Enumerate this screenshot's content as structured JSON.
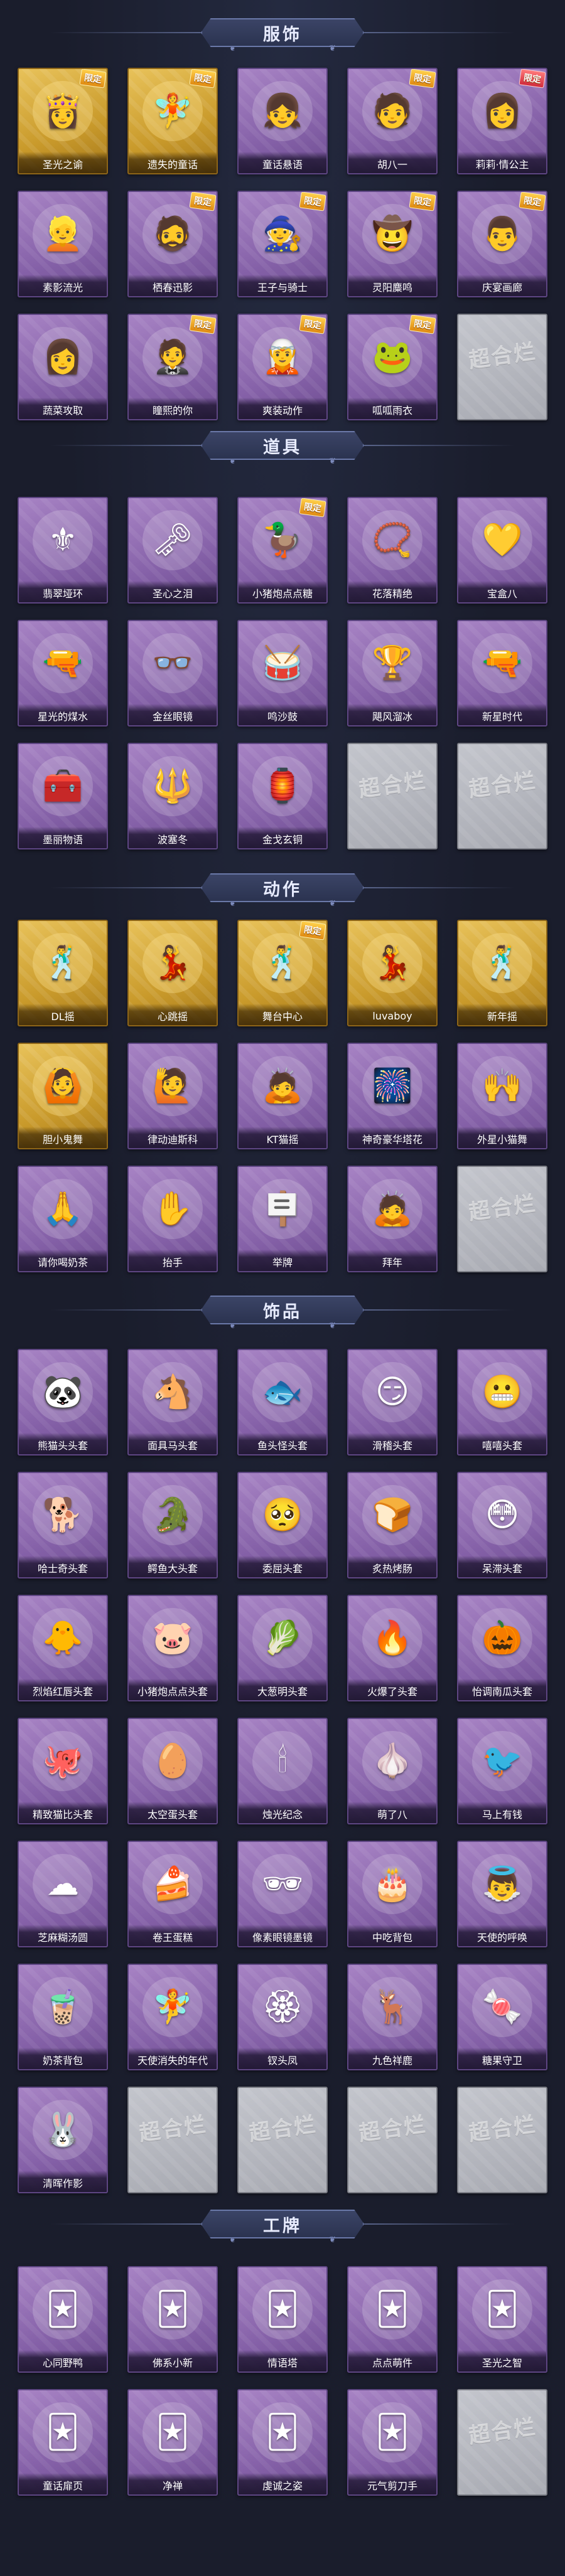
{
  "placeholder_logo": "超合烂",
  "sections": [
    {
      "title": "服饰",
      "items": [
        {
          "name": "圣光之谕",
          "tier": "gold",
          "icon": "girl-portrait",
          "glyph": "👸",
          "badge": "限定"
        },
        {
          "name": "遗失的童话",
          "tier": "gold",
          "icon": "girl-portrait",
          "glyph": "🧚",
          "badge": "限定"
        },
        {
          "name": "童话悬语",
          "tier": "purple",
          "icon": "girl-portrait",
          "glyph": "👧"
        },
        {
          "name": "胡八一",
          "tier": "purple",
          "icon": "boy-portrait",
          "glyph": "🧑",
          "badge": "限定"
        },
        {
          "name": "莉莉·情公主",
          "tier": "purple",
          "icon": "girl-portrait",
          "glyph": "👩",
          "badge": "限定",
          "badge_color": "red"
        },
        {
          "name": "素影流光",
          "tier": "purple",
          "icon": "girl-portrait",
          "glyph": "👱"
        },
        {
          "name": "栖春迅影",
          "tier": "purple",
          "icon": "boy-portrait",
          "glyph": "🧔",
          "badge": "限定"
        },
        {
          "name": "王子与骑士",
          "tier": "purple",
          "icon": "boy-portrait",
          "glyph": "🧙",
          "badge": "限定"
        },
        {
          "name": "灵阳麋鸣",
          "tier": "purple",
          "icon": "boy-portrait",
          "glyph": "🤠",
          "badge": "限定"
        },
        {
          "name": "庆宴画廊",
          "tier": "purple",
          "icon": "boy-portrait",
          "glyph": "👨",
          "badge": "限定"
        },
        {
          "name": "蔬菜攻取",
          "tier": "purple",
          "icon": "girl-portrait",
          "glyph": "👩"
        },
        {
          "name": "瞳熙的你",
          "tier": "purple",
          "icon": "girl-portrait",
          "glyph": "🤵",
          "badge": "限定"
        },
        {
          "name": "爽装动作",
          "tier": "purple",
          "icon": "girl-portrait",
          "glyph": "🧝",
          "badge": "限定"
        },
        {
          "name": "呱呱雨衣",
          "tier": "purple",
          "icon": "frog-portrait",
          "glyph": "🐸",
          "badge": "限定"
        },
        {
          "name": "",
          "tier": "grey",
          "icon": "placeholder-logo",
          "glyph": ""
        }
      ]
    },
    {
      "title": "道具",
      "items": [
        {
          "name": "翡翠垭环",
          "tier": "purple",
          "icon": "scepter-icon",
          "glyph": "⚜"
        },
        {
          "name": "圣心之泪",
          "tier": "purple",
          "icon": "key-icon",
          "glyph": "🗝"
        },
        {
          "name": "小猪炮点点糖",
          "tier": "purple",
          "icon": "duck-icon",
          "glyph": "🦆",
          "badge": "限定"
        },
        {
          "name": "花落精绝",
          "tier": "purple",
          "icon": "necklace-icon",
          "glyph": "📿"
        },
        {
          "name": "宝盒八",
          "tier": "purple",
          "icon": "heart-locket-icon",
          "glyph": "💛"
        },
        {
          "name": "星光的煤水",
          "tier": "purple",
          "icon": "rifle-icon",
          "glyph": "🔫"
        },
        {
          "name": "金丝眼镜",
          "tier": "purple",
          "icon": "glasses-icon",
          "glyph": "👓"
        },
        {
          "name": "鸣沙鼓",
          "tier": "purple",
          "icon": "drum-icon",
          "glyph": "🥁"
        },
        {
          "name": "飓风溜冰",
          "tier": "purple",
          "icon": "trophy-icon",
          "glyph": "🏆"
        },
        {
          "name": "新星时代",
          "tier": "purple",
          "icon": "pistol-icon",
          "glyph": "🔫"
        },
        {
          "name": "墨丽物语",
          "tier": "purple",
          "icon": "medkit-icon",
          "glyph": "🧰"
        },
        {
          "name": "波塞冬",
          "tier": "purple",
          "icon": "trident-icon",
          "glyph": "🔱"
        },
        {
          "name": "金戈玄铜",
          "tier": "purple",
          "icon": "lantern-icon",
          "glyph": "🏮"
        },
        {
          "name": "",
          "tier": "grey",
          "icon": "placeholder-logo",
          "glyph": ""
        },
        {
          "name": "",
          "tier": "grey",
          "icon": "placeholder-logo",
          "glyph": ""
        }
      ]
    },
    {
      "title": "动作",
      "items": [
        {
          "name": "DL摇",
          "tier": "gold",
          "icon": "dance-pose-icon",
          "glyph": "🕺"
        },
        {
          "name": "心跳摇",
          "tier": "gold",
          "icon": "dance-pose-icon",
          "glyph": "💃"
        },
        {
          "name": "舞台中心",
          "tier": "gold",
          "icon": "dance-pose-icon",
          "glyph": "🕺",
          "badge": "限定"
        },
        {
          "name": "luvaboy",
          "tier": "gold",
          "icon": "dance-pose-icon",
          "glyph": "💃"
        },
        {
          "name": "新年摇",
          "tier": "gold",
          "icon": "dance-pose-icon",
          "glyph": "🕺"
        },
        {
          "name": "胆小鬼舞",
          "tier": "gold",
          "icon": "dance-pose-icon",
          "glyph": "🙆"
        },
        {
          "name": "律动迪斯科",
          "tier": "purple",
          "icon": "dance-pose-icon",
          "glyph": "🙋"
        },
        {
          "name": "KT猫摇",
          "tier": "purple",
          "icon": "dance-pose-icon",
          "glyph": "🙇"
        },
        {
          "name": "神奇豪华塔花",
          "tier": "purple",
          "icon": "firework-icon",
          "glyph": "🎆"
        },
        {
          "name": "外星小猫舞",
          "tier": "purple",
          "icon": "dance-pose-icon",
          "glyph": "🙌"
        },
        {
          "name": "请你喝奶茶",
          "tier": "purple",
          "icon": "dance-pose-icon",
          "glyph": "🙏"
        },
        {
          "name": "抬手",
          "tier": "purple",
          "icon": "dance-pose-icon",
          "glyph": "✋"
        },
        {
          "name": "举牌",
          "tier": "purple",
          "icon": "sign-pose-icon",
          "glyph": "🪧"
        },
        {
          "name": "拜年",
          "tier": "purple",
          "icon": "bow-pose-icon",
          "glyph": "🙇"
        },
        {
          "name": "",
          "tier": "grey",
          "icon": "placeholder-logo",
          "glyph": ""
        }
      ]
    },
    {
      "title": "饰品",
      "items": [
        {
          "name": "熊猫头头套",
          "tier": "purple",
          "icon": "panda-head-icon",
          "glyph": "🐼"
        },
        {
          "name": "面具马头套",
          "tier": "purple",
          "icon": "horse-head-icon",
          "glyph": "🐴"
        },
        {
          "name": "鱼头怪头套",
          "tier": "purple",
          "icon": "fish-head-icon",
          "glyph": "🐟"
        },
        {
          "name": "滑稽头套",
          "tier": "purple",
          "icon": "smile-face-icon",
          "glyph": "😏"
        },
        {
          "name": "嘻嘻头套",
          "tier": "purple",
          "icon": "grin-face-icon",
          "glyph": "😬"
        },
        {
          "name": "哈士奇头套",
          "tier": "purple",
          "icon": "dog-head-icon",
          "glyph": "🐕"
        },
        {
          "name": "鳄鱼大头套",
          "tier": "purple",
          "icon": "crocodile-head-icon",
          "glyph": "🐊"
        },
        {
          "name": "委屈头套",
          "tier": "purple",
          "icon": "sad-face-icon",
          "glyph": "🥺"
        },
        {
          "name": "炙热烤肠",
          "tier": "purple",
          "icon": "toast-head-icon",
          "glyph": "🍞"
        },
        {
          "name": "呆滞头套",
          "tier": "purple",
          "icon": "stare-face-icon",
          "glyph": "😳"
        },
        {
          "name": "烈焰红唇头套",
          "tier": "purple",
          "icon": "pikachu-head-icon",
          "glyph": "🐥"
        },
        {
          "name": "小猪炮点点头套",
          "tier": "purple",
          "icon": "blob-head-icon",
          "glyph": "🐷"
        },
        {
          "name": "大葱明头套",
          "tier": "purple",
          "icon": "leek-head-icon",
          "glyph": "🥬"
        },
        {
          "name": "火爆了头套",
          "tier": "purple",
          "icon": "fire-head-icon",
          "glyph": "🔥"
        },
        {
          "name": "怡调南瓜头套",
          "tier": "purple",
          "icon": "pumpkin-head-icon",
          "glyph": "🎃"
        },
        {
          "name": "精致猫比头套",
          "tier": "purple",
          "icon": "pink-blob-icon",
          "glyph": "🐙"
        },
        {
          "name": "太空蛋头套",
          "tier": "purple",
          "icon": "egg-head-icon",
          "glyph": "🥚"
        },
        {
          "name": "烛光纪念",
          "tier": "purple",
          "icon": "candle-head-icon",
          "glyph": "🕯"
        },
        {
          "name": "萌了八",
          "tier": "purple",
          "icon": "garlic-head-icon",
          "glyph": "🧄"
        },
        {
          "name": "马上有钱",
          "tier": "purple",
          "icon": "bird-head-icon",
          "glyph": "🐦"
        },
        {
          "name": "芝麻糊汤圆",
          "tier": "purple",
          "icon": "cloud-head-icon",
          "glyph": "☁"
        },
        {
          "name": "卷王蛋糕",
          "tier": "purple",
          "icon": "cake-icon",
          "glyph": "🍰"
        },
        {
          "name": "像素眼镜墨镜",
          "tier": "purple",
          "icon": "pixel-glasses-icon",
          "glyph": "🕶"
        },
        {
          "name": "中吃背包",
          "tier": "purple",
          "icon": "cake-backpack-icon",
          "glyph": "🎂"
        },
        {
          "name": "天使的呼唤",
          "tier": "purple",
          "icon": "angel-doll-icon",
          "glyph": "👼"
        },
        {
          "name": "奶茶背包",
          "tier": "purple",
          "icon": "milk-tea-backpack-icon",
          "glyph": "🧋"
        },
        {
          "name": "天使消失的年代",
          "tier": "purple",
          "icon": "fairy-doll-icon",
          "glyph": "🧚"
        },
        {
          "name": "钗头凤",
          "tier": "purple",
          "icon": "hairpin-icon",
          "glyph": "🏵"
        },
        {
          "name": "九色祥鹿",
          "tier": "purple",
          "icon": "deer-icon",
          "glyph": "🦌"
        },
        {
          "name": "糖果守卫",
          "tier": "purple",
          "icon": "candy-bag-icon",
          "glyph": "🍬"
        },
        {
          "name": "清晖作影",
          "tier": "purple",
          "icon": "rabbit-doll-icon",
          "glyph": "🐰"
        },
        {
          "name": "",
          "tier": "grey",
          "icon": "placeholder-logo",
          "glyph": ""
        },
        {
          "name": "",
          "tier": "grey",
          "icon": "placeholder-logo",
          "glyph": ""
        },
        {
          "name": "",
          "tier": "grey",
          "icon": "placeholder-logo",
          "glyph": ""
        },
        {
          "name": "",
          "tier": "grey",
          "icon": "placeholder-logo",
          "glyph": ""
        }
      ]
    },
    {
      "title": "工牌",
      "items": [
        {
          "name": "心同野鸭",
          "tier": "purple",
          "icon": "badge-card-icon",
          "glyph": "🃏"
        },
        {
          "name": "佛系小新",
          "tier": "purple",
          "icon": "badge-card-icon",
          "glyph": "🃏"
        },
        {
          "name": "情语塔",
          "tier": "purple",
          "icon": "badge-card-icon",
          "glyph": "🃏"
        },
        {
          "name": "点点萌件",
          "tier": "purple",
          "icon": "badge-card-icon",
          "glyph": "🃏"
        },
        {
          "name": "圣光之智",
          "tier": "purple",
          "icon": "badge-card-icon",
          "glyph": "🃏"
        },
        {
          "name": "童话扉页",
          "tier": "purple",
          "icon": "badge-card-icon",
          "glyph": "🃏"
        },
        {
          "name": "净禅",
          "tier": "purple",
          "icon": "badge-card-icon",
          "glyph": "🃏"
        },
        {
          "name": "虔诚之姿",
          "tier": "purple",
          "icon": "badge-card-icon",
          "glyph": "🃏"
        },
        {
          "name": "元气剪刀手",
          "tier": "purple",
          "icon": "badge-card-icon",
          "glyph": "🃏"
        },
        {
          "name": "",
          "tier": "grey",
          "icon": "placeholder-logo",
          "glyph": ""
        }
      ]
    }
  ]
}
